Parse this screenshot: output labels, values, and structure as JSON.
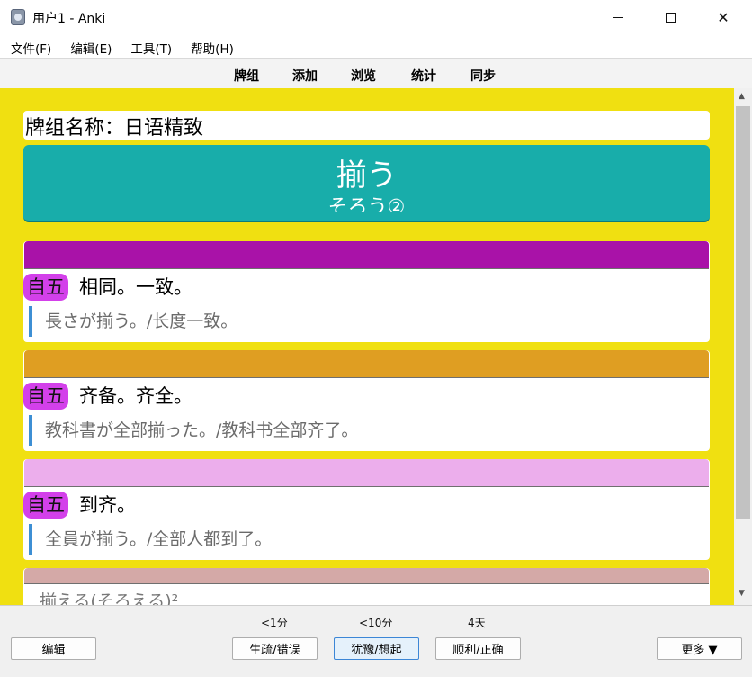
{
  "window": {
    "title": "用户1 - Anki"
  },
  "menu": [
    "文件(F)",
    "编辑(E)",
    "工具(T)",
    "帮助(H)"
  ],
  "toolbar": [
    "牌组",
    "添加",
    "浏览",
    "统计",
    "同步"
  ],
  "card": {
    "deck_name": "牌组名称：日语精致",
    "word": "揃う",
    "reading": "そろう②",
    "senses": [
      {
        "bar_color": "#a912a8",
        "pos": "自五",
        "definition": "相同。一致。",
        "example": "長さが揃う。/长度一致。"
      },
      {
        "bar_color": "#df9e22",
        "pos": "自五",
        "definition": "齐备。齐全。",
        "example": "教科書が全部揃った。/教科书全部齐了。"
      },
      {
        "bar_color": "#ecaeec",
        "pos": "自五",
        "definition": "到齐。",
        "example": "全員が揃う。/全部人都到了。"
      }
    ],
    "next_section": {
      "bar_color": "#d4a9a7",
      "text": "揃える(そろえる)²"
    }
  },
  "bottom": {
    "edit_label": "编辑",
    "more_label": "更多 ▼",
    "answers": [
      {
        "time": "<1分",
        "label": "生疏/错误"
      },
      {
        "time": "<10分",
        "label": "犹豫/想起"
      },
      {
        "time": "4天",
        "label": "顺利/正确"
      }
    ]
  }
}
